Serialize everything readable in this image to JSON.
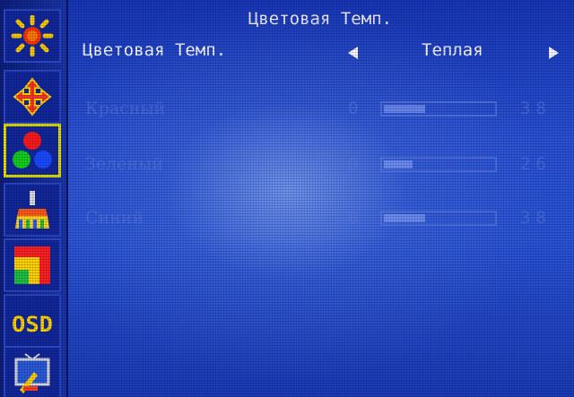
{
  "menu": {
    "title": "Цветовая Темп.",
    "sidebar": [
      {
        "icon": "brightness-sun-icon"
      },
      {
        "icon": "position-arrows-icon"
      },
      {
        "icon": "color-dots-icon",
        "active": true
      },
      {
        "icon": "paint-brush-icon"
      },
      {
        "icon": "color-blocks-icon"
      },
      {
        "icon": "osd-icon"
      },
      {
        "icon": "tools-tv-icon"
      }
    ],
    "color_temp": {
      "label": "Цветовая Темп.",
      "value": "Теплая"
    },
    "rows": [
      {
        "label": "Красный",
        "min": "0",
        "value_text": "38",
        "value": 38
      },
      {
        "label": "Зеленый",
        "min": "0",
        "value_text": "26",
        "value": 26
      },
      {
        "label": "Синий",
        "min": "0",
        "value_text": "38",
        "value": 38
      }
    ]
  }
}
